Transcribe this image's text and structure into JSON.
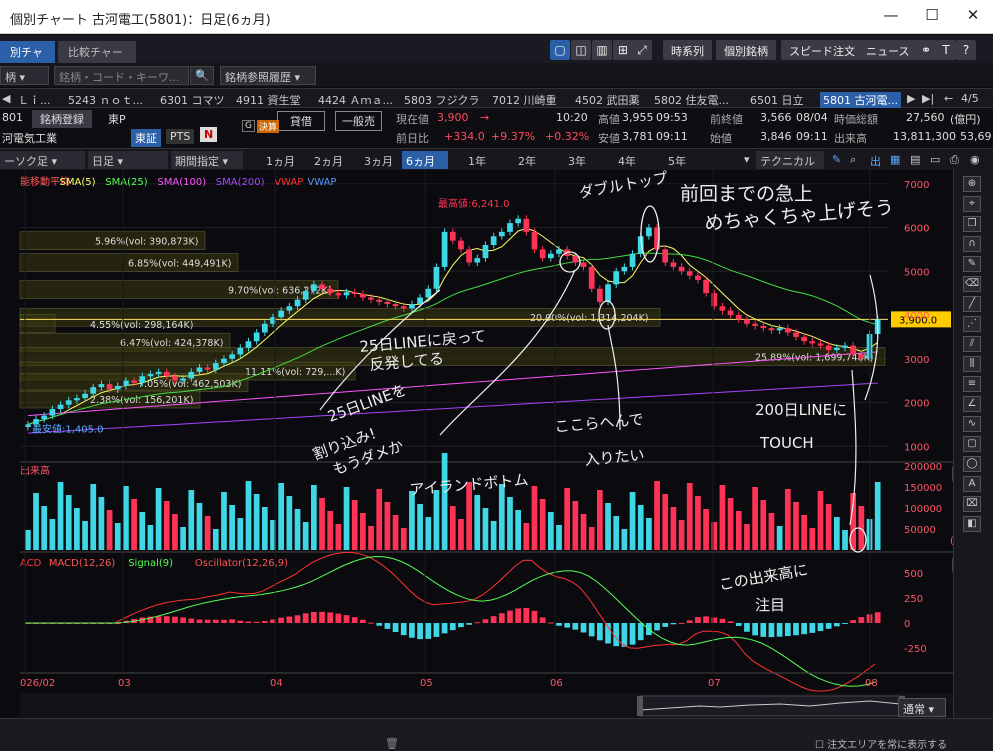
{
  "window": {
    "title": "個別チャート 古河電工(5801)：日足(6ヵ月)",
    "minimize": "—",
    "maximize": "☐",
    "close": "✕"
  },
  "tabs": [
    {
      "label": "別チャート",
      "active": true
    },
    {
      "label": "比較チャート",
      "active": false
    }
  ],
  "header_buttons": {
    "timeseries": "時系列",
    "stock": "個別銘柄",
    "speed": "スピード注文",
    "news": "ニュース",
    "text_icon": "T",
    "help_icon": "?"
  },
  "row2": {
    "select1": "柄",
    "search_placeholder": "銘柄・コード・キーワ...",
    "search_icon": "🔍",
    "history": "銘柄参照履歴"
  },
  "ticker": {
    "items": [
      "Ｌｉ...",
      "5243 ｎｏｔ...",
      "6301 コマツ",
      "4911 資生堂",
      "4424 Ａｍａ...",
      "5803 フジクラ",
      "7012 川崎重",
      "4502 武田薬",
      "5802 住友電...",
      "6501 日立",
      "5801 古河電..."
    ],
    "page": "4/5"
  },
  "info": {
    "code": "801",
    "name": "河電気工業",
    "register": "銘柄登録",
    "market": "東P",
    "tse": "東証",
    "pts": "PTS",
    "n": "N",
    "g": "G",
    "settle": "決算",
    "lend": "貸借",
    "general": "一般売",
    "price_label": "現在値",
    "price": "3,900",
    "arrow": "→",
    "time": "10:20",
    "change_label": "前日比",
    "change": "+334.0",
    "change_pct": "+9.37%",
    "extra_pct": "+0.32%",
    "high_label": "高値",
    "high": "3,955",
    "high_time": "09:53",
    "low_label": "安値",
    "low": "3,781",
    "low_time": "09:11",
    "prev_label": "前終値",
    "prev": "3,566",
    "prev_date": "08/04",
    "open_label": "始値",
    "open": "3,846",
    "open_time": "09:11",
    "mcap_label": "時価総額",
    "mcap": "27,560",
    "mcap_unit": "(億円)",
    "vol_label": "出来高",
    "vol": "13,811,300",
    "vol2": "53,69"
  },
  "period": {
    "candle": "ーソク足",
    "daily": "日足",
    "range": "期間指定",
    "options": [
      "1ヵ月",
      "2ヵ月",
      "3ヵ月",
      "6ヵ月",
      "1年",
      "2年",
      "3年",
      "4年",
      "5年"
    ],
    "active": "6ヵ月",
    "technical": "テクニカル"
  },
  "chart_data": {
    "type": "candlestick",
    "legend": [
      {
        "name": "能移動平均",
        "color": "#ff5555"
      },
      {
        "name": "SMA(5)",
        "color": "#ffff66"
      },
      {
        "name": "SMA(25)",
        "color": "#55ff55"
      },
      {
        "name": "SMA(100)",
        "color": "#ff55ff"
      },
      {
        "name": "SMA(200)",
        "color": "#aa44ff"
      },
      {
        "name": "VWAP",
        "color": "#ff3333"
      },
      {
        "name": "VWAP",
        "color": "#5599ff"
      }
    ],
    "y_ticks": [
      "7000",
      "6000",
      "5000",
      "4000",
      "3000",
      "2000",
      "1000"
    ],
    "ylim": [
      800,
      7200
    ],
    "max_label": "最高値:6,241.0",
    "min_label": "最安値:1,405.0",
    "current_price_label": "3,900.0",
    "volume_profile": [
      "5.96%(vol: 390,873K)",
      "6.85%(vol: 449,491K)",
      "9.70%(vol: 636,272K)",
      "20.00%(vol: 1,314,204K)",
      "4.55%(vol: 298,164K)",
      "6.47%(vol: 424,378K)",
      "25.89%(vol: 1,699,748K)",
      "11.11%(vol: 729,...K)",
      "7.05%(vol: 462,503K)",
      "2.38%(vol: 156,201K)"
    ],
    "x_ticks": [
      "026/02",
      "03",
      "04",
      "05",
      "06",
      "07",
      "08"
    ],
    "closes": [
      1500,
      1620,
      1700,
      1850,
      1950,
      2050,
      2100,
      2200,
      2350,
      2420,
      2300,
      2380,
      2500,
      2450,
      2600,
      2650,
      2700,
      2600,
      2500,
      2550,
      2700,
      2800,
      2750,
      2900,
      3000,
      3100,
      3250,
      3400,
      3600,
      3800,
      3950,
      4100,
      4200,
      4350,
      4550,
      4700,
      4600,
      4500,
      4450,
      4520,
      4480,
      4400,
      4350,
      4300,
      4250,
      4200,
      4150,
      4250,
      4400,
      4600,
      5100,
      5900,
      5700,
      5500,
      5200,
      5300,
      5600,
      5800,
      5900,
      6100,
      6200,
      5900,
      5500,
      5300,
      5400,
      5500,
      5350,
      5200,
      5100,
      4600,
      4300,
      4700,
      5000,
      5100,
      5400,
      5800,
      6000,
      5500,
      5200,
      5100,
      5000,
      4900,
      4800,
      4500,
      4200,
      4100,
      4000,
      3900,
      3800,
      3750,
      3700,
      3650,
      3700,
      3600,
      3500,
      3400,
      3350,
      3300,
      3200,
      3250,
      3300,
      3100,
      3000,
      3566,
      3900
    ]
  },
  "volume_panel": {
    "label": "出来高",
    "ticks": [
      "200000",
      "150000",
      "100000",
      "50000"
    ],
    "unit": "(K)"
  },
  "macd_panel": {
    "legend": [
      {
        "name": "ACD",
        "color": "#ff3333"
      },
      {
        "name": "MACD(12,26)",
        "color": "#ff5555"
      },
      {
        "name": "Signal(9)",
        "color": "#55ff55"
      },
      {
        "name": "Oscillator(12,26,9)",
        "color": "#ff5555"
      }
    ],
    "ticks": [
      "500",
      "250",
      "0",
      "-250"
    ]
  },
  "annotations": [
    "ダブルトップ",
    "前回までの急上",
    "めちゃくちゃ上げそう",
    "25日LINEに戻って",
    "反発してる",
    "25日LINEを",
    "割り込み!",
    "もうダメか",
    "アイランドボトム",
    "ここらへんで",
    "入りたい",
    "200日LINEに",
    "TOUCH",
    "この出来高に",
    "注目"
  ],
  "bottom": {
    "mode": "通常",
    "trash_icon": "🗑",
    "always_show": "注文エリアを常に表示する"
  }
}
